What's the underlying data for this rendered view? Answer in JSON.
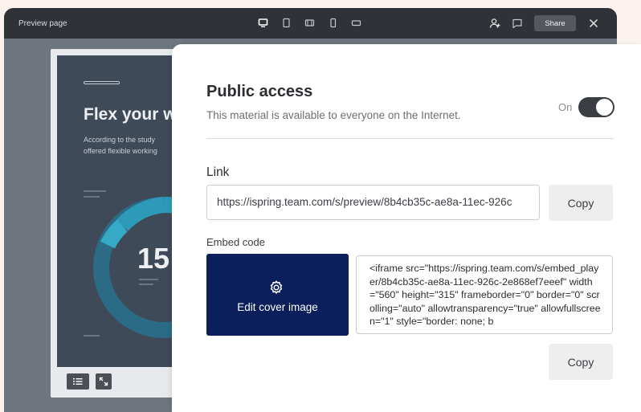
{
  "window": {
    "title": "Preview page",
    "device_icons": [
      "desktop-icon",
      "tablet-portrait-icon",
      "tablet-landscape-icon",
      "phone-portrait-icon",
      "phone-landscape-icon"
    ],
    "share_label": "Share"
  },
  "slide": {
    "heading": "Flex your w",
    "subtitle_line1": "According to the study",
    "subtitle_line2": "offered flexible working",
    "big_number": "15",
    "accent_color": "#2d9bb8"
  },
  "panel": {
    "public_access": {
      "title": "Public access",
      "description": "This material is available to everyone on the Internet.",
      "toggle_label": "On",
      "toggle_on": true
    },
    "link": {
      "label": "Link",
      "value": "https://ispring.team.com/s/preview/8b4cb35c-ae8a-11ec-926c",
      "copy_label": "Copy"
    },
    "embed": {
      "label": "Embed code",
      "cover_button_label": "Edit cover image",
      "code": "<iframe src=\"https://ispring.team.com/s/embed_player/8b4cb35c-ae8a-11ec-926c-2e868ef7eeef\" width=\"560\" height=\"315\" frameborder=\"0\" border=\"0\" scrolling=\"auto\" allowtransparency=\"true\" allowfullscreen=\"1\" style=\"border: none; b",
      "copy_label": "Copy"
    }
  },
  "colors": {
    "titlebar": "#2f3237",
    "cover_button": "#0b1f5c",
    "toggle": "#3a3d42"
  }
}
